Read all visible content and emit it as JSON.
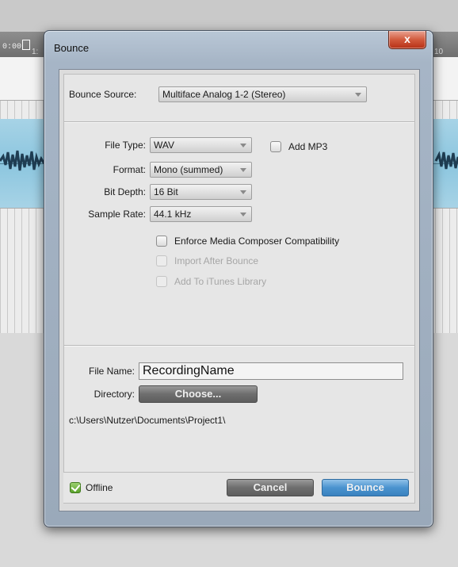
{
  "background": {
    "timecode": "0:00",
    "ruler_left_mark": "1:",
    "ruler_right_mark": "10"
  },
  "window": {
    "title": "Bounce",
    "close_label": "x"
  },
  "bounce_source": {
    "label": "Bounce Source:",
    "value": "Multiface Analog 1-2 (Stereo)"
  },
  "file_type": {
    "label": "File Type:",
    "value": "WAV"
  },
  "add_mp3": {
    "label": "Add MP3",
    "checked": false
  },
  "format": {
    "label": "Format:",
    "value": "Mono (summed)"
  },
  "bit_depth": {
    "label": "Bit Depth:",
    "value": "16 Bit"
  },
  "sample_rate": {
    "label": "Sample Rate:",
    "value": "44.1 kHz"
  },
  "options": {
    "enforce": {
      "label": "Enforce Media Composer Compatibility",
      "checked": false,
      "enabled": true
    },
    "import_after": {
      "label": "Import After Bounce",
      "checked": false,
      "enabled": false
    },
    "add_itunes": {
      "label": "Add To iTunes Library",
      "checked": false,
      "enabled": false
    }
  },
  "file_name": {
    "label": "File Name:",
    "value": "RecordingName"
  },
  "directory": {
    "label": "Directory:",
    "button_label": "Choose...",
    "path": "c:\\Users\\Nutzer\\Documents\\Project1\\"
  },
  "footer": {
    "offline_label": "Offline",
    "offline_checked": true,
    "cancel_label": "Cancel",
    "bounce_label": "Bounce"
  },
  "colors": {
    "accent_blue": "#4a93cf",
    "offline_green": "#5aa22a",
    "close_red": "#d25a3d"
  }
}
